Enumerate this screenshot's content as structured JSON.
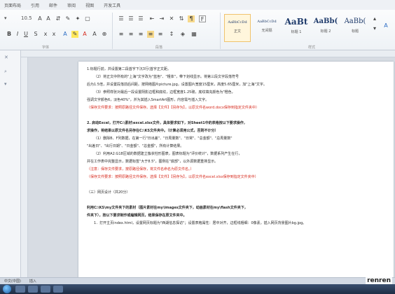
{
  "ribbon": {
    "tabs": [
      "页面布局",
      "引用",
      "邮件",
      "审阅",
      "视图",
      "开发工具"
    ],
    "font_size": "10.5",
    "group_labels": [
      "字体",
      "段落",
      "样式"
    ],
    "styles": [
      {
        "sample": "AaBbCcDd",
        "name": "正文"
      },
      {
        "sample": "AaBbCcDd",
        "name": "无间隔"
      },
      {
        "sample": "AaBt",
        "name": "标题 1"
      },
      {
        "sample": "AaBb(",
        "name": "标题 2"
      },
      {
        "sample": "AaBb(",
        "name": "标题"
      }
    ]
  },
  "document": {
    "lines": [
      {
        "text": "1.标题行前，并设置第二段首字下沉3行(首字正文距。",
        "style": ""
      },
      {
        "text": "（2）将正文中所有的\"上海\"文字改为\"蓝色\"、\"粗体\"，带下划线显示。将第三段文字段落符号",
        "style": "indent"
      },
      {
        "text": "后为1.5倍，并设置段落前后间距。按网络图片picture.jpg，设置图片宽度15厘米，高度5.65厘米，加\"上海\"文字。",
        "style": ""
      },
      {
        "text": "（3）参照样张对最后一段设置阴影边框和底纹，边框宽度1.25磅，底纹填充颜色为\"橙色，",
        "style": "indent"
      },
      {
        "text": "强调文字颜色6，淡色40%\"，并为其插入SmartArt图形，内容需与插入文字。",
        "style": ""
      },
      {
        "text": "（保存文件要求：按照原路径文件保存。选择【文件】【另存为】，以原文件名word.docx保存到指定文件夹中）",
        "style": "red"
      },
      {
        "text": "",
        "style": "gap"
      },
      {
        "text": "2. 启动Excel，打开C:\\素材\\excel.xlsx文件，具体要求如下，对Sheet1中的表格按以下要求操作，",
        "style": "bold"
      },
      {
        "text": "求操作，将结果以原文件名另存在C:\\KS文件夹中。（计算必须用公式，否则不计分）",
        "style": "bold"
      },
      {
        "text": "（1）删除B、F列数据，在第一行\"日出差\"、\"日周量数\"、\"日常\"、\"总金额\"、\"总周量数\"",
        "style": "indent"
      },
      {
        "text": "\"出差日\"、\"出行日期\"、\"日金额\"、\"总金额\"，所有计算结果。",
        "style": ""
      },
      {
        "text": "（2）利用A2:G18区域的数据建立簇状柱形图表，图表标题为\"评价统计\"，数据系列产生在行，",
        "style": "indent"
      },
      {
        "text": "并在工作表中完整显示，数据标签\"大于8.5\"，图例在\"底部\"，以外源数据重排显示。",
        "style": ""
      },
      {
        "text": "（注意：保存文件要求，按原路径保存，将文件名命名为原文件名。）",
        "style": "red"
      },
      {
        "text": "（保存文件要求：按照原路径文件保存。选择【文件】【另存为】，以原文件名excel.xlsx保存到指定文件夹中）",
        "style": "red"
      },
      {
        "text": "",
        "style": "gap"
      },
      {
        "text": "（三）网页设计（共20分）",
        "style": ""
      },
      {
        "text": "",
        "style": "gap"
      },
      {
        "text": "利用C:\\KS\\my文件夹下的素材（图片素材在my\\images文件夹下，动画素材在my\\flash文件夹下，",
        "style": "bold"
      },
      {
        "text": "件夹下），按以下要求制作或编辑网页，结果保存在原文件夹中。",
        "style": "bold"
      },
      {
        "text": "1．打开主页index.html，设置网页标题为\"西湖信息探访\"；设置表格属性：居中对齐，边框线粗细：0像素，插入网页背景图片bg.jpg。",
        "style": "indent"
      }
    ]
  },
  "statusbar": {
    "language": "中文(中国)",
    "mode": "插入"
  },
  "watermark": "renren"
}
